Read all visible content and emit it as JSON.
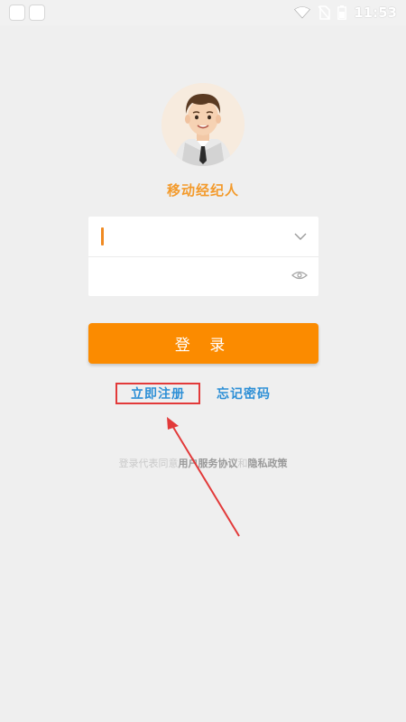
{
  "status_bar": {
    "time": "11:53",
    "icons": [
      "wifi-icon",
      "no-sim-icon",
      "battery-icon"
    ]
  },
  "app": {
    "name": "移动经纪人",
    "avatar_icon": "agent-avatar-icon",
    "accent_color": "#fb8b00",
    "link_color": "#2d8fd6"
  },
  "login_form": {
    "phone": {
      "value": "",
      "placeholder": "",
      "dropdown_icon": "chevron-down-icon"
    },
    "password": {
      "value": "",
      "placeholder": "",
      "toggle_icon": "eye-icon"
    },
    "login_label": "登 录"
  },
  "links": {
    "register_label": "立即注册",
    "forgot_label": "忘记密码"
  },
  "terms": {
    "prefix": "登录代表同意",
    "user_agreement": "用户服务协议",
    "and": "和",
    "privacy": "隐私政策"
  },
  "annotation": {
    "arrow_color": "#e23a3a"
  }
}
